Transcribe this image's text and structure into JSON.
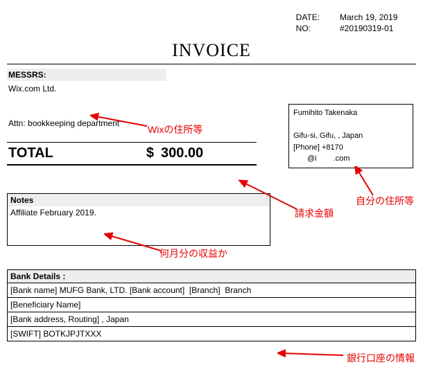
{
  "meta": {
    "date_label": "DATE:",
    "date_value": "March 19, 2019",
    "no_label": "NO:",
    "no_value": "#20190319-01"
  },
  "title": "INVOICE",
  "messrs": {
    "header": "MESSRS:",
    "line1": "Wix.com Ltd.",
    "redacted": "                                  ",
    "attn": "Attn: bookkeeping department"
  },
  "sender": {
    "name": "Fumihito Takenaka",
    "redacted1": "                                        ",
    "city_line_pre": "Gifu-si, Gifu, ",
    "city_line_post": ", Japan",
    "phone_pre": "[Phone] +8170",
    "email_pre": "     @i      .com",
    "redacted2": "          ",
    "redacted3": "       "
  },
  "total": {
    "label": "TOTAL",
    "currency": "$",
    "amount": "300.00"
  },
  "notes": {
    "header": "Notes",
    "body": "Affiliate February 2019."
  },
  "bank": {
    "header": "Bank Details :",
    "row1_pre": "[Bank name] MUFG Bank, LTD.  [Bank account] ",
    "row1_mid": "  [Branch] ",
    "row1_post": " Branch",
    "row2_pre": "[Beneficiary Name] ",
    "row3_pre": "[Bank address, Routing] ",
    "row3_post": ", Japan",
    "row4": "[SWIFT] BOTKJPJTXXX"
  },
  "annotations": {
    "wix_addr": "Wixの住所等",
    "own_addr": "自分の住所等",
    "amount": "請求金額",
    "month": "何月分の収益か",
    "bank_info": "銀行口座の情報"
  }
}
